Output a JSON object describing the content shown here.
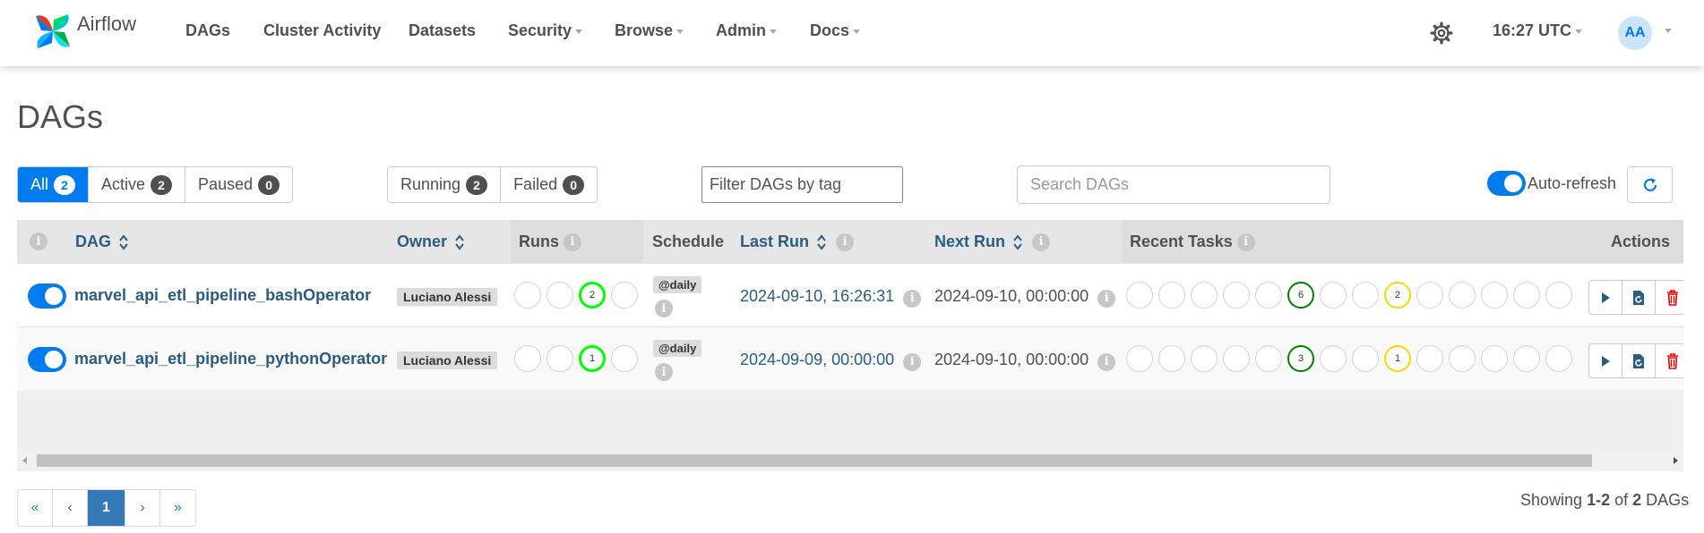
{
  "brand": {
    "name": "Airflow"
  },
  "nav": {
    "items": [
      {
        "label": "DAGs",
        "dropdown": false
      },
      {
        "label": "Cluster Activity",
        "dropdown": false
      },
      {
        "label": "Datasets",
        "dropdown": false
      },
      {
        "label": "Security",
        "dropdown": true
      },
      {
        "label": "Browse",
        "dropdown": true
      },
      {
        "label": "Admin",
        "dropdown": true
      },
      {
        "label": "Docs",
        "dropdown": true
      }
    ],
    "time": "16:27 UTC",
    "user_initials": "AA"
  },
  "page_title": "DAGs",
  "filters": {
    "status": [
      {
        "label": "All",
        "count": "2",
        "active": true
      },
      {
        "label": "Active",
        "count": "2",
        "active": false
      },
      {
        "label": "Paused",
        "count": "0",
        "active": false
      }
    ],
    "runs": [
      {
        "label": "Running",
        "count": "2"
      },
      {
        "label": "Failed",
        "count": "0"
      }
    ],
    "tag_placeholder": "Filter DAGs by tag",
    "search_placeholder": "Search DAGs",
    "auto_refresh_label": "Auto-refresh",
    "auto_refresh_on": true
  },
  "table": {
    "columns": {
      "dag": "DAG",
      "owner": "Owner",
      "runs": "Runs",
      "schedule": "Schedule",
      "last_run": "Last Run",
      "next_run": "Next Run",
      "recent_tasks": "Recent Tasks",
      "actions": "Actions"
    },
    "rows": [
      {
        "dag_id": "marvel_api_etl_pipeline_bashOperator",
        "enabled": true,
        "owner": "Luciano Alessi",
        "runs": [
          "",
          "",
          "2",
          ""
        ],
        "schedule": "@daily",
        "last_run": "2024-09-10, 16:26:31",
        "next_run": "2024-09-10, 00:00:00",
        "recent_tasks": [
          "",
          "",
          "",
          "",
          "",
          "6",
          "",
          "",
          "2",
          "",
          "",
          "",
          "",
          ""
        ]
      },
      {
        "dag_id": "marvel_api_etl_pipeline_pythonOperator",
        "enabled": true,
        "owner": "Luciano Alessi",
        "runs": [
          "",
          "",
          "1",
          ""
        ],
        "schedule": "@daily",
        "last_run": "2024-09-09, 00:00:00",
        "next_run": "2024-09-10, 00:00:00",
        "recent_tasks": [
          "",
          "",
          "",
          "",
          "",
          "3",
          "",
          "",
          "1",
          "",
          "",
          "",
          "",
          ""
        ]
      }
    ]
  },
  "pagination": {
    "first": "«",
    "prev": "‹",
    "current": "1",
    "next": "›",
    "last": "»"
  },
  "showing": {
    "prefix": "Showing",
    "range": "1-2",
    "of": "of",
    "total": "2",
    "suffix": "DAGs"
  },
  "colors": {
    "primary": "#017cee",
    "link": "#2a5d84",
    "run_running": "#00ff00",
    "task_success": "#008000",
    "task_queued": "#ffd700",
    "delete": "#ff0000"
  },
  "info_glyph": "i"
}
